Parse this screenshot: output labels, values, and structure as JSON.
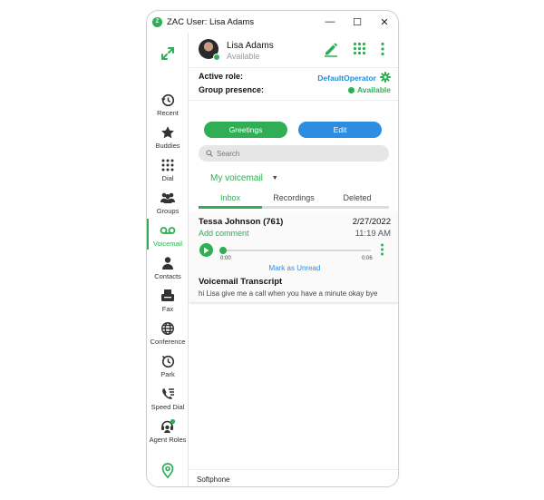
{
  "window": {
    "title": "ZAC User: Lisa Adams",
    "app_icon_text": "Z",
    "minimize": "—",
    "maximize": "☐",
    "close": "✕"
  },
  "colors": {
    "green": "#2fae55",
    "blue": "#2d8de0"
  },
  "sidebar": {
    "items": [
      {
        "label": "Recent",
        "icon": "history-icon"
      },
      {
        "label": "Buddies",
        "icon": "star-icon"
      },
      {
        "label": "Dial",
        "icon": "dialpad-icon"
      },
      {
        "label": "Groups",
        "icon": "group-icon"
      },
      {
        "label": "Voicemail",
        "icon": "voicemail-icon",
        "active": true
      },
      {
        "label": "Contacts",
        "icon": "contact-icon"
      },
      {
        "label": "Fax",
        "icon": "fax-icon"
      },
      {
        "label": "Conference",
        "icon": "globe-icon"
      },
      {
        "label": "Park",
        "icon": "park-icon"
      },
      {
        "label": "Speed Dial",
        "icon": "speed-dial-icon"
      },
      {
        "label": "Agent Roles",
        "icon": "agent-icon"
      }
    ]
  },
  "user": {
    "name": "Lisa Adams",
    "status": "Available"
  },
  "role": {
    "label": "Active role:",
    "value": "DefaultOperator"
  },
  "presence": {
    "label": "Group presence:",
    "value": "Available"
  },
  "buttons": {
    "greetings": "Greetings",
    "edit": "Edit"
  },
  "search": {
    "placeholder": "Search"
  },
  "voicemail_select": {
    "value": "My voicemail"
  },
  "tabs": [
    "Inbox",
    "Recordings",
    "Deleted"
  ],
  "voicemail": {
    "caller": "Tessa Johnson (761)",
    "date": "2/27/2022",
    "add_comment": "Add comment",
    "time": "11:19 AM",
    "position": "0:00",
    "duration": "0:06",
    "mark_unread": "Mark as Unread",
    "transcript_title": "Voicemail Transcript",
    "transcript_text": "hi Lisa give me a call when you have a minute okay bye"
  },
  "footer": {
    "label": "Softphone"
  }
}
